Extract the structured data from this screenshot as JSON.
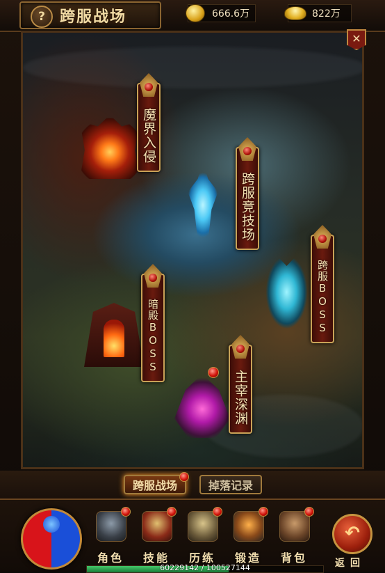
{
  "header": {
    "help_label": "?",
    "title": "跨服战场",
    "currency_gold": "666.6万",
    "currency_ingot": "822万",
    "close_label": "✕"
  },
  "map": {
    "locations": [
      {
        "label": "魔界入侵"
      },
      {
        "label": "跨服竞技场"
      },
      {
        "label": "跨服BOSS"
      },
      {
        "label": "暗殿BOSS"
      },
      {
        "label": "主宰深渊"
      }
    ]
  },
  "tabs": [
    {
      "label": "跨服战场",
      "active": true
    },
    {
      "label": "掉落记录",
      "active": false
    }
  ],
  "menu": {
    "items": [
      {
        "label": "角色",
        "icon": "helmet-icon"
      },
      {
        "label": "技能",
        "icon": "skill-book-icon"
      },
      {
        "label": "历练",
        "icon": "armor-icon"
      },
      {
        "label": "锻造",
        "icon": "anvil-icon"
      },
      {
        "label": "背包",
        "icon": "bag-icon"
      }
    ],
    "back_icon": "↶",
    "back_label": "返回"
  },
  "exp": {
    "text": "60229142 / 100527144",
    "progress": 0.599
  },
  "colors": {
    "accent_gold": "#c9a257",
    "banner_red": "#6a1a0e",
    "exp_green": "#45c86a"
  }
}
